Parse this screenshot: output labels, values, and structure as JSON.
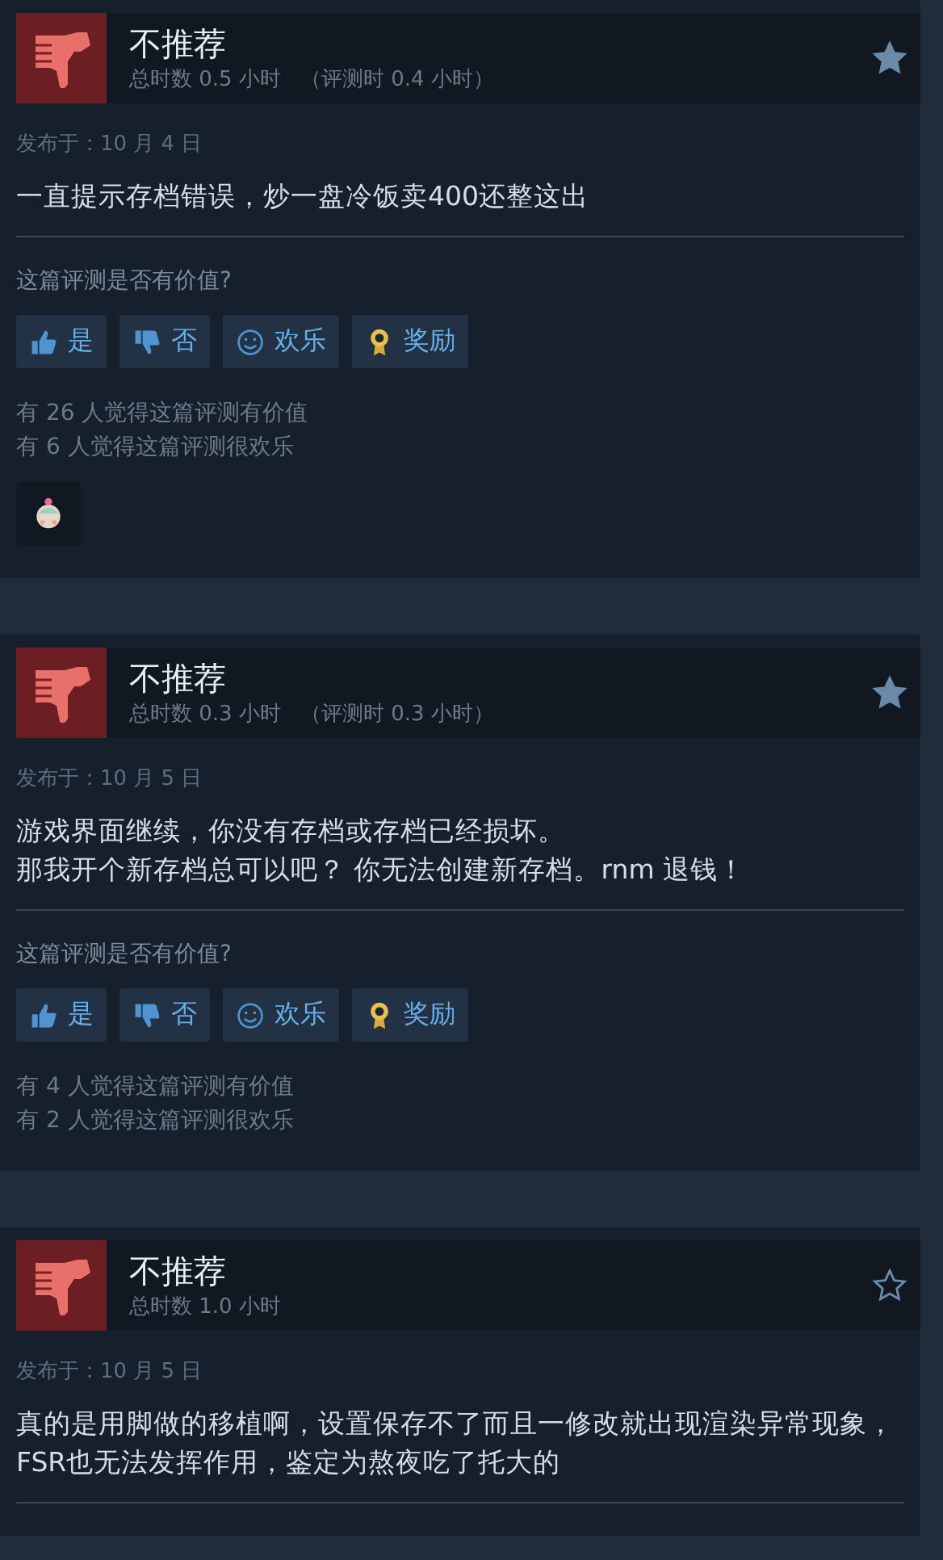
{
  "reviews": [
    {
      "verdict": "不推荐",
      "recommended": false,
      "hours": "总时数 0.5 小时",
      "review_hours": "（评测时 0.4 小时）",
      "starred": true,
      "posted": "发布于：10 月 4 日",
      "paragraphs": [
        "一直提示存档错误，炒一盘冷饭卖400还整这出"
      ],
      "question": "这篇评测是否有价值?",
      "votes": [
        {
          "kind": "yes",
          "label": "是"
        },
        {
          "kind": "no",
          "label": "否"
        },
        {
          "kind": "funny",
          "label": "欢乐"
        },
        {
          "kind": "award",
          "label": "奖励"
        }
      ],
      "counts": [
        "有 26 人觉得这篇评测有价值",
        "有 6 人觉得这篇评测很欢乐"
      ],
      "awards": [
        {
          "kind": "sticker"
        }
      ]
    },
    {
      "verdict": "不推荐",
      "recommended": false,
      "hours": "总时数 0.3 小时",
      "review_hours": "（评测时 0.3 小时）",
      "starred": true,
      "posted": "发布于：10 月 5 日",
      "paragraphs": [
        "游戏界面继续，你没有存档或存档已经损坏。",
        "那我开个新存档总可以吧？ 你无法创建新存档。rnm 退钱！"
      ],
      "question": "这篇评测是否有价值?",
      "votes": [
        {
          "kind": "yes",
          "label": "是"
        },
        {
          "kind": "no",
          "label": "否"
        },
        {
          "kind": "funny",
          "label": "欢乐"
        },
        {
          "kind": "award",
          "label": "奖励"
        }
      ],
      "counts": [
        "有 4 人觉得这篇评测有价值",
        "有 2 人觉得这篇评测很欢乐"
      ]
    },
    {
      "verdict": "不推荐",
      "recommended": false,
      "hours": "总时数 1.0 小时",
      "starred": false,
      "posted": "发布于：10 月 5 日",
      "paragraphs": [
        "真的是用脚做的移植啊，设置保存不了而且一修改就出现渲染异常现象，FSR也无法发挥作用，鉴定为熬夜吃了托大的"
      ]
    }
  ]
}
